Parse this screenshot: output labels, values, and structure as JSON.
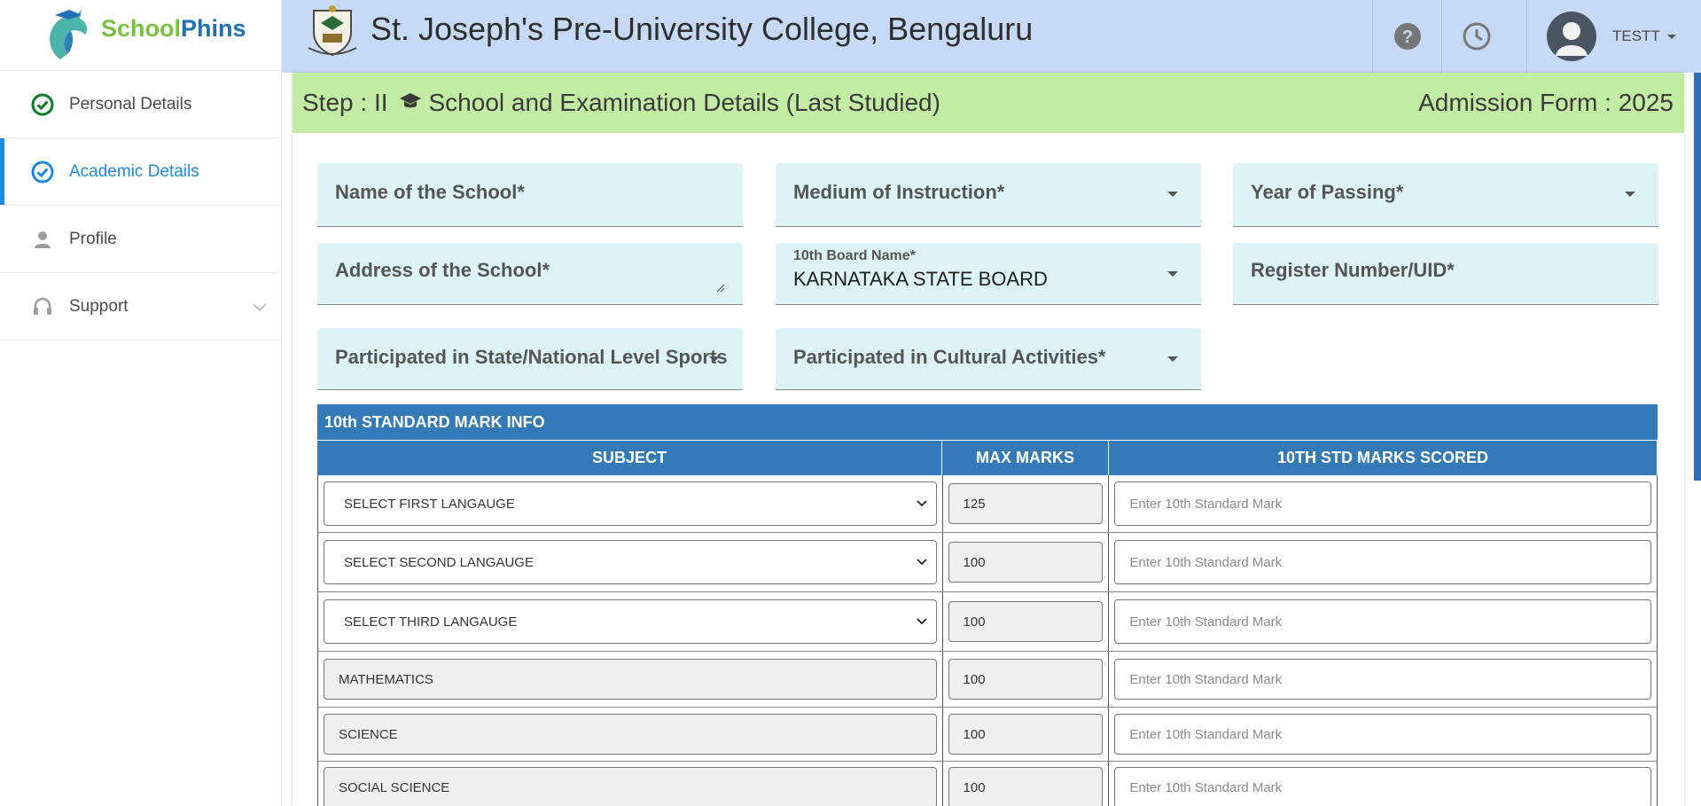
{
  "brand": {
    "part1": "School",
    "part2": "Phins"
  },
  "sidebar": {
    "items": [
      {
        "label": "Personal Details",
        "icon": "check-circle-icon",
        "state": "done"
      },
      {
        "label": "Academic Details",
        "icon": "check-circle-icon",
        "state": "active"
      },
      {
        "label": "Profile",
        "icon": "person-icon",
        "state": "normal"
      },
      {
        "label": "Support",
        "icon": "headset-icon",
        "state": "normal"
      }
    ]
  },
  "header": {
    "college": "St. Joseph's Pre-University College, Bengaluru",
    "user": "TESTT"
  },
  "step": {
    "label": "Step : II",
    "title": "School and Examination Details (Last Studied)",
    "form": "Admission Form : 2025"
  },
  "fields": {
    "school_name": "Name of the School*",
    "medium": "Medium of Instruction*",
    "year": "Year of Passing*",
    "address": "Address of the School*",
    "board_label": "10th Board Name*",
    "board_value": "KARNATAKA STATE BOARD",
    "register": "Register Number/UID*",
    "sports": "Participated in State/National Level Sports",
    "cultural": "Participated in Cultural Activities*"
  },
  "table": {
    "title": "10th STANDARD MARK INFO",
    "headers": [
      "SUBJECT",
      "MAX MARKS",
      "10TH STD MARKS SCORED"
    ],
    "placeholder": "Enter 10th Standard Mark",
    "rows": [
      {
        "subject": "SELECT FIRST LANGAUGE",
        "max": "125"
      },
      {
        "subject": "SELECT SECOND LANGAUGE",
        "max": "100"
      },
      {
        "subject": "SELECT THIRD LANGAUGE",
        "max": "100"
      },
      {
        "subject": "MATHEMATICS",
        "max": "100"
      },
      {
        "subject": "SCIENCE",
        "max": "100"
      },
      {
        "subject": "SOCIAL SCIENCE",
        "max": "100"
      }
    ]
  },
  "colors": {
    "accent": "#1e88e5",
    "header_bg": "#c7daf5",
    "step_bg": "#c2eba4",
    "table_header": "#337ab7",
    "field_bg": "#ddf3f8"
  }
}
